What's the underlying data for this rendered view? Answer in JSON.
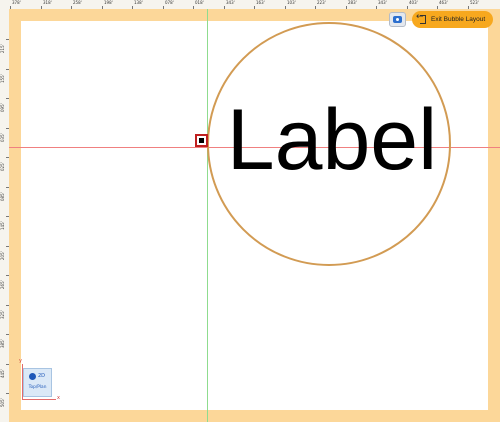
{
  "ruler": {
    "top_ticks": [
      "378'",
      "318'",
      "258'",
      "198'",
      "138'",
      "078'",
      "018'",
      "343'",
      "163'",
      "103'",
      "223'",
      "283'",
      "343'",
      "403'",
      "463'",
      "523'"
    ],
    "left_ticks": [
      "215'",
      "155'",
      "095'",
      "035'",
      "025'",
      "085'",
      "145'",
      "205'",
      "265'",
      "325'",
      "385'",
      "445'",
      "505'",
      "565'"
    ]
  },
  "canvas_label": {
    "text": "Label",
    "circle_color": "#d29b53"
  },
  "toolbar": {
    "exit_button_label": "Exit Bubble Layout",
    "exit_button_color": "#f7a81e",
    "eye_icon": "eye-icon"
  },
  "view_widget": {
    "mode": "2D",
    "plane": "Top/Plan"
  },
  "axes": {
    "x_label": "x",
    "y_label": "y"
  },
  "colors": {
    "frame": "#fcd799",
    "guide_vertical": "#8fdc8f",
    "guide_horizontal": "#f08080",
    "anchor_border": "#c02020"
  }
}
